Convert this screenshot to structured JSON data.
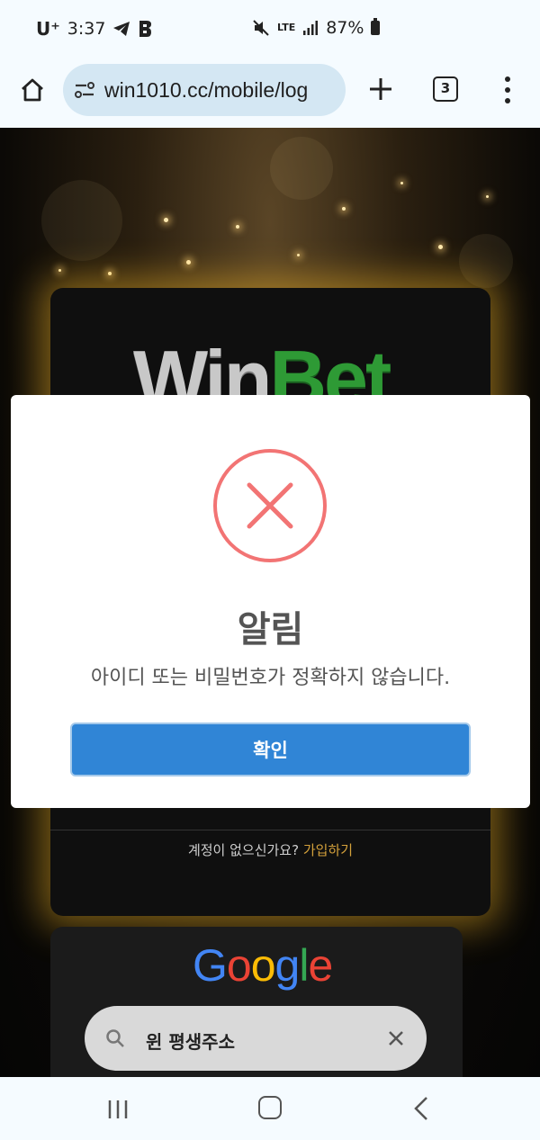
{
  "status_bar": {
    "carrier": "U⁺",
    "time": "3:37",
    "network": "LTE",
    "battery": "87%"
  },
  "browser": {
    "url": "win1010.cc/mobile/log",
    "tab_count": "3"
  },
  "login_card": {
    "logo_part1": "Win",
    "logo_part2": "Bet",
    "signup_prompt": "계정이 없으신가요?",
    "signup_link": "가입하기"
  },
  "google_widget": {
    "logo_letters": [
      "G",
      "o",
      "o",
      "g",
      "l",
      "e"
    ],
    "search_query": "윈 평생주소"
  },
  "modal": {
    "title": "알림",
    "message": "아이디 또는 비밀번호가 정확하지 않습니다.",
    "confirm_label": "확인",
    "accent_color": "#f27474",
    "button_color": "#3085d6"
  }
}
